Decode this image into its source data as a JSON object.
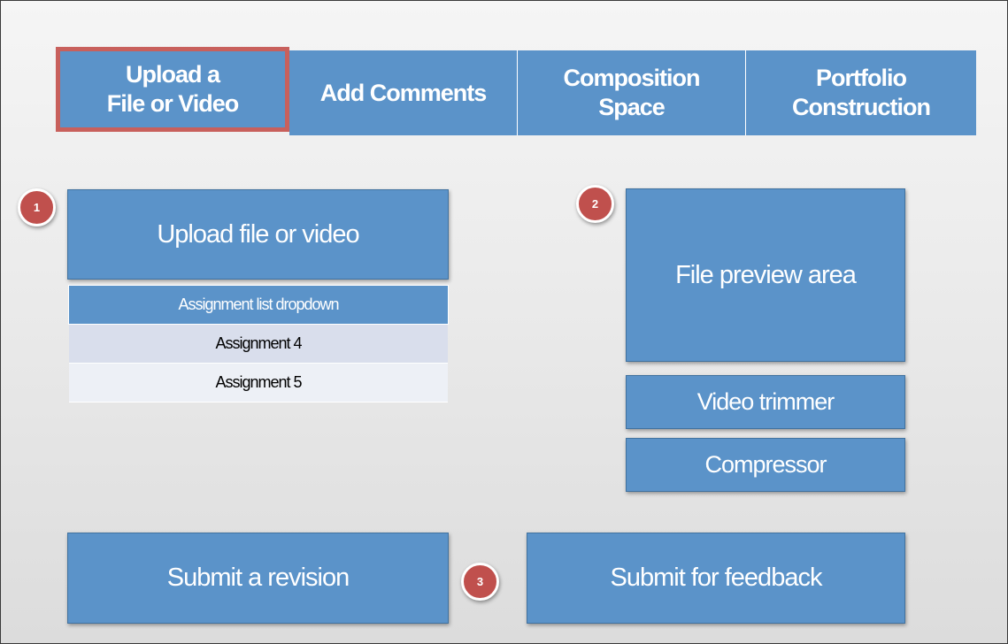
{
  "tabs": [
    {
      "line1": "Upload a",
      "line2": "File or Video"
    },
    {
      "line1": "Add Comments"
    },
    {
      "line1": "Composition",
      "line2": "Space"
    },
    {
      "line1": "Portfolio",
      "line2": "Construction"
    }
  ],
  "steps": {
    "one": "1",
    "two": "2",
    "three": "3"
  },
  "upload": {
    "label": "Upload file or video"
  },
  "assignment_dropdown": {
    "header": "Assignment list dropdown",
    "options": [
      "Assignment 4",
      "Assignment 5"
    ]
  },
  "preview": {
    "label": "File preview area"
  },
  "tools": {
    "video_trimmer": "Video trimmer",
    "compressor": "Compressor"
  },
  "actions": {
    "submit_revision": "Submit a revision",
    "submit_feedback": "Submit for feedback"
  },
  "colors": {
    "box_blue": "#5b93c9",
    "active_tab_border": "#c8605c",
    "badge_red": "#c0504d",
    "option_1_bg": "#d9deec",
    "option_2_bg": "#edf0f6"
  }
}
